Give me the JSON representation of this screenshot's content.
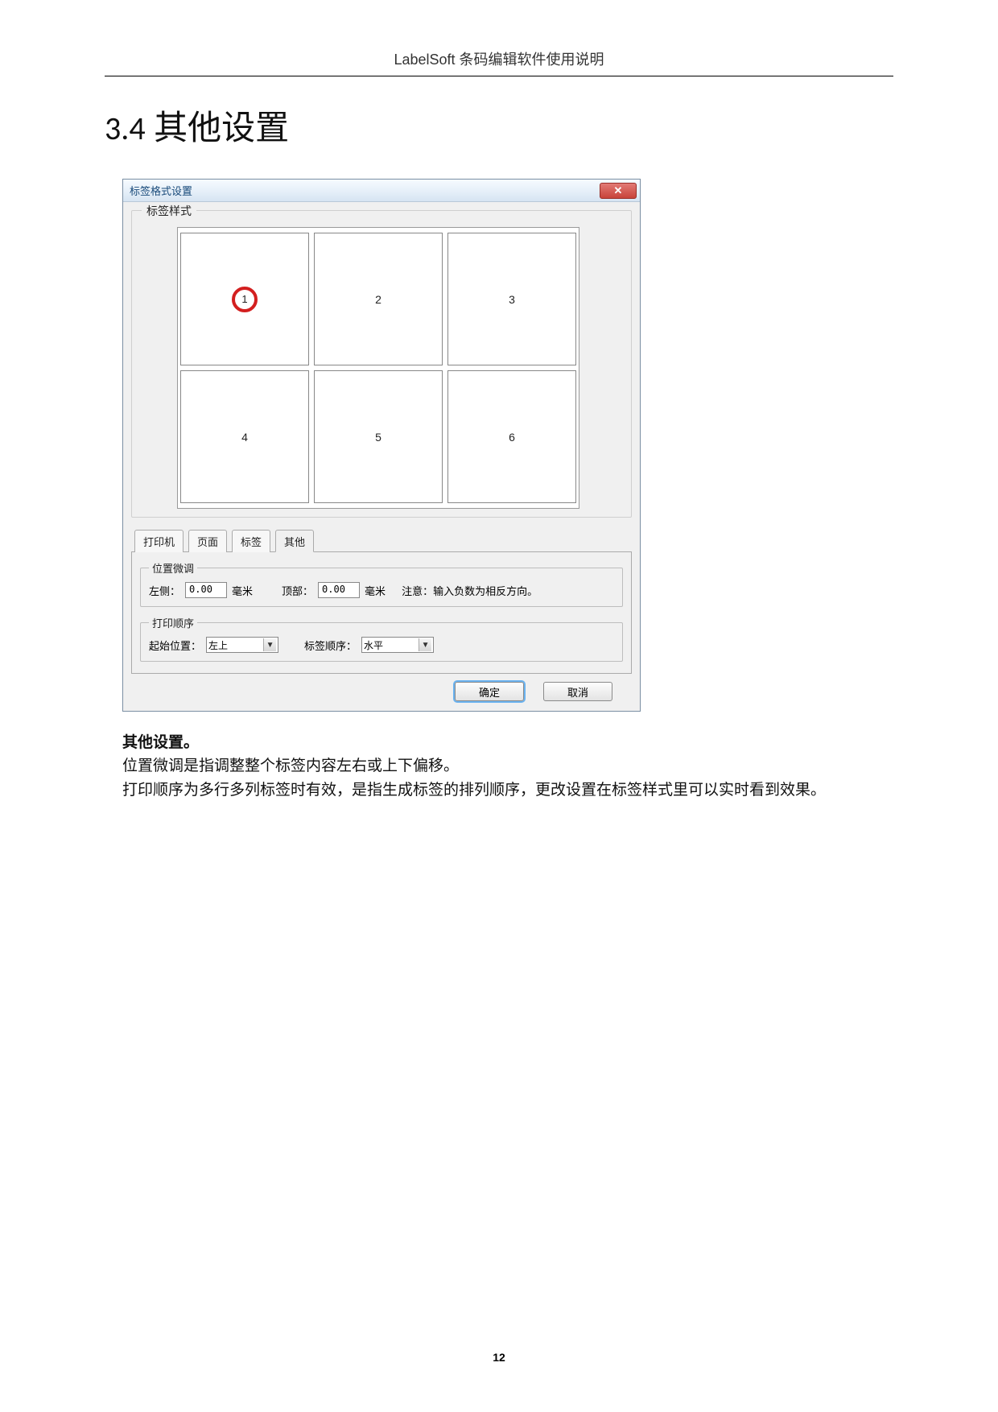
{
  "doc": {
    "header": "LabelSoft 条码编辑软件使用说明",
    "section_number": "3.4",
    "section_title": "其他设置",
    "page_number": "12"
  },
  "dialog": {
    "title": "标签格式设置",
    "close_glyph": "✕",
    "preview_legend": "标签样式",
    "cells": [
      "1",
      "2",
      "3",
      "4",
      "5",
      "6"
    ],
    "selected_cell_index": 0,
    "tabs": [
      "打印机",
      "页面",
      "标签",
      "其他"
    ],
    "active_tab_index": 3,
    "position": {
      "legend": "位置微调",
      "left_label": "左侧：",
      "left_value": "0.00",
      "left_unit": "毫米",
      "top_label": "顶部：",
      "top_value": "0.00",
      "top_unit": "毫米",
      "note": "注意：输入负数为相反方向。"
    },
    "order": {
      "legend": "打印顺序",
      "start_label": "起始位置：",
      "start_value": "左上",
      "order_label": "标签顺序：",
      "order_value": "水平"
    },
    "buttons": {
      "ok": "确定",
      "cancel": "取消"
    }
  },
  "desc": {
    "lead": "其他设置。",
    "line1": "位置微调是指调整整个标签内容左右或上下偏移。",
    "line2": "打印顺序为多行多列标签时有效，是指生成标签的排列顺序，更改设置在标签样式里可以实时看到效果。"
  }
}
